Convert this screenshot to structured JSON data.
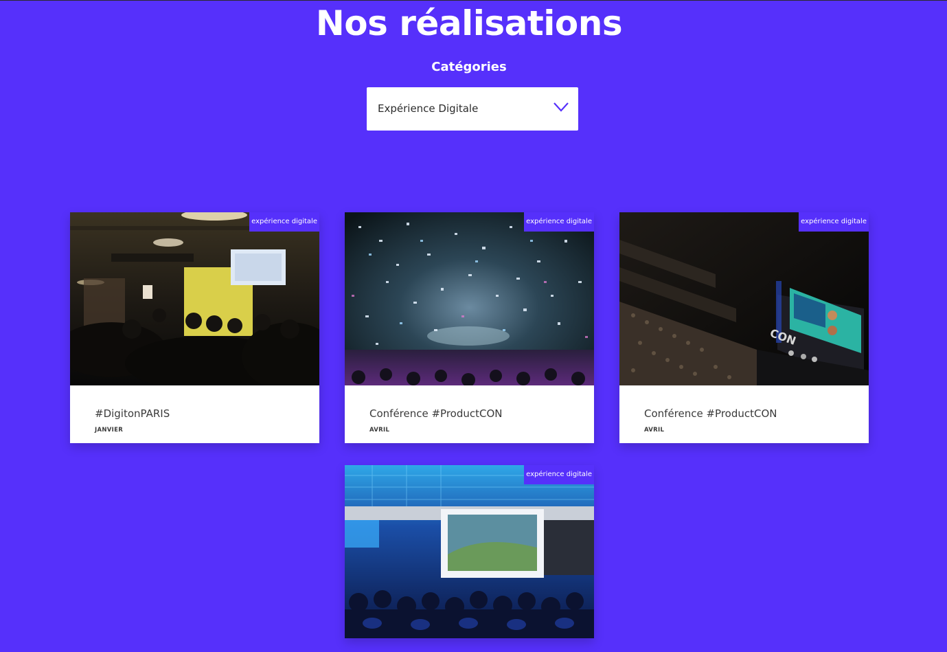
{
  "header": {
    "title": "Nos réalisations",
    "categories_label": "Catégories"
  },
  "filter": {
    "selected": "Expérience Digitale",
    "icon": "chevron-down-icon",
    "accent": "#5630fb"
  },
  "colors": {
    "background": "#5630fb",
    "card": "#ffffff",
    "badge": "#5630fb"
  },
  "cards": [
    {
      "badge": "expérience digitale",
      "title": "#DigitonPARIS",
      "date": "JANVIER",
      "image": "photo-conference-room-speaker"
    },
    {
      "badge": "expérience digitale",
      "title": "Conférence #ProductCON",
      "date": "AVRIL",
      "image": "photo-confetti-crowd"
    },
    {
      "badge": "expérience digitale",
      "title": "Conférence #ProductCON",
      "date": "AVRIL",
      "image": "photo-auditorium-stage"
    },
    {
      "badge": "expérience digitale",
      "title": "",
      "date": "",
      "image": "photo-blue-audience-screen"
    }
  ]
}
